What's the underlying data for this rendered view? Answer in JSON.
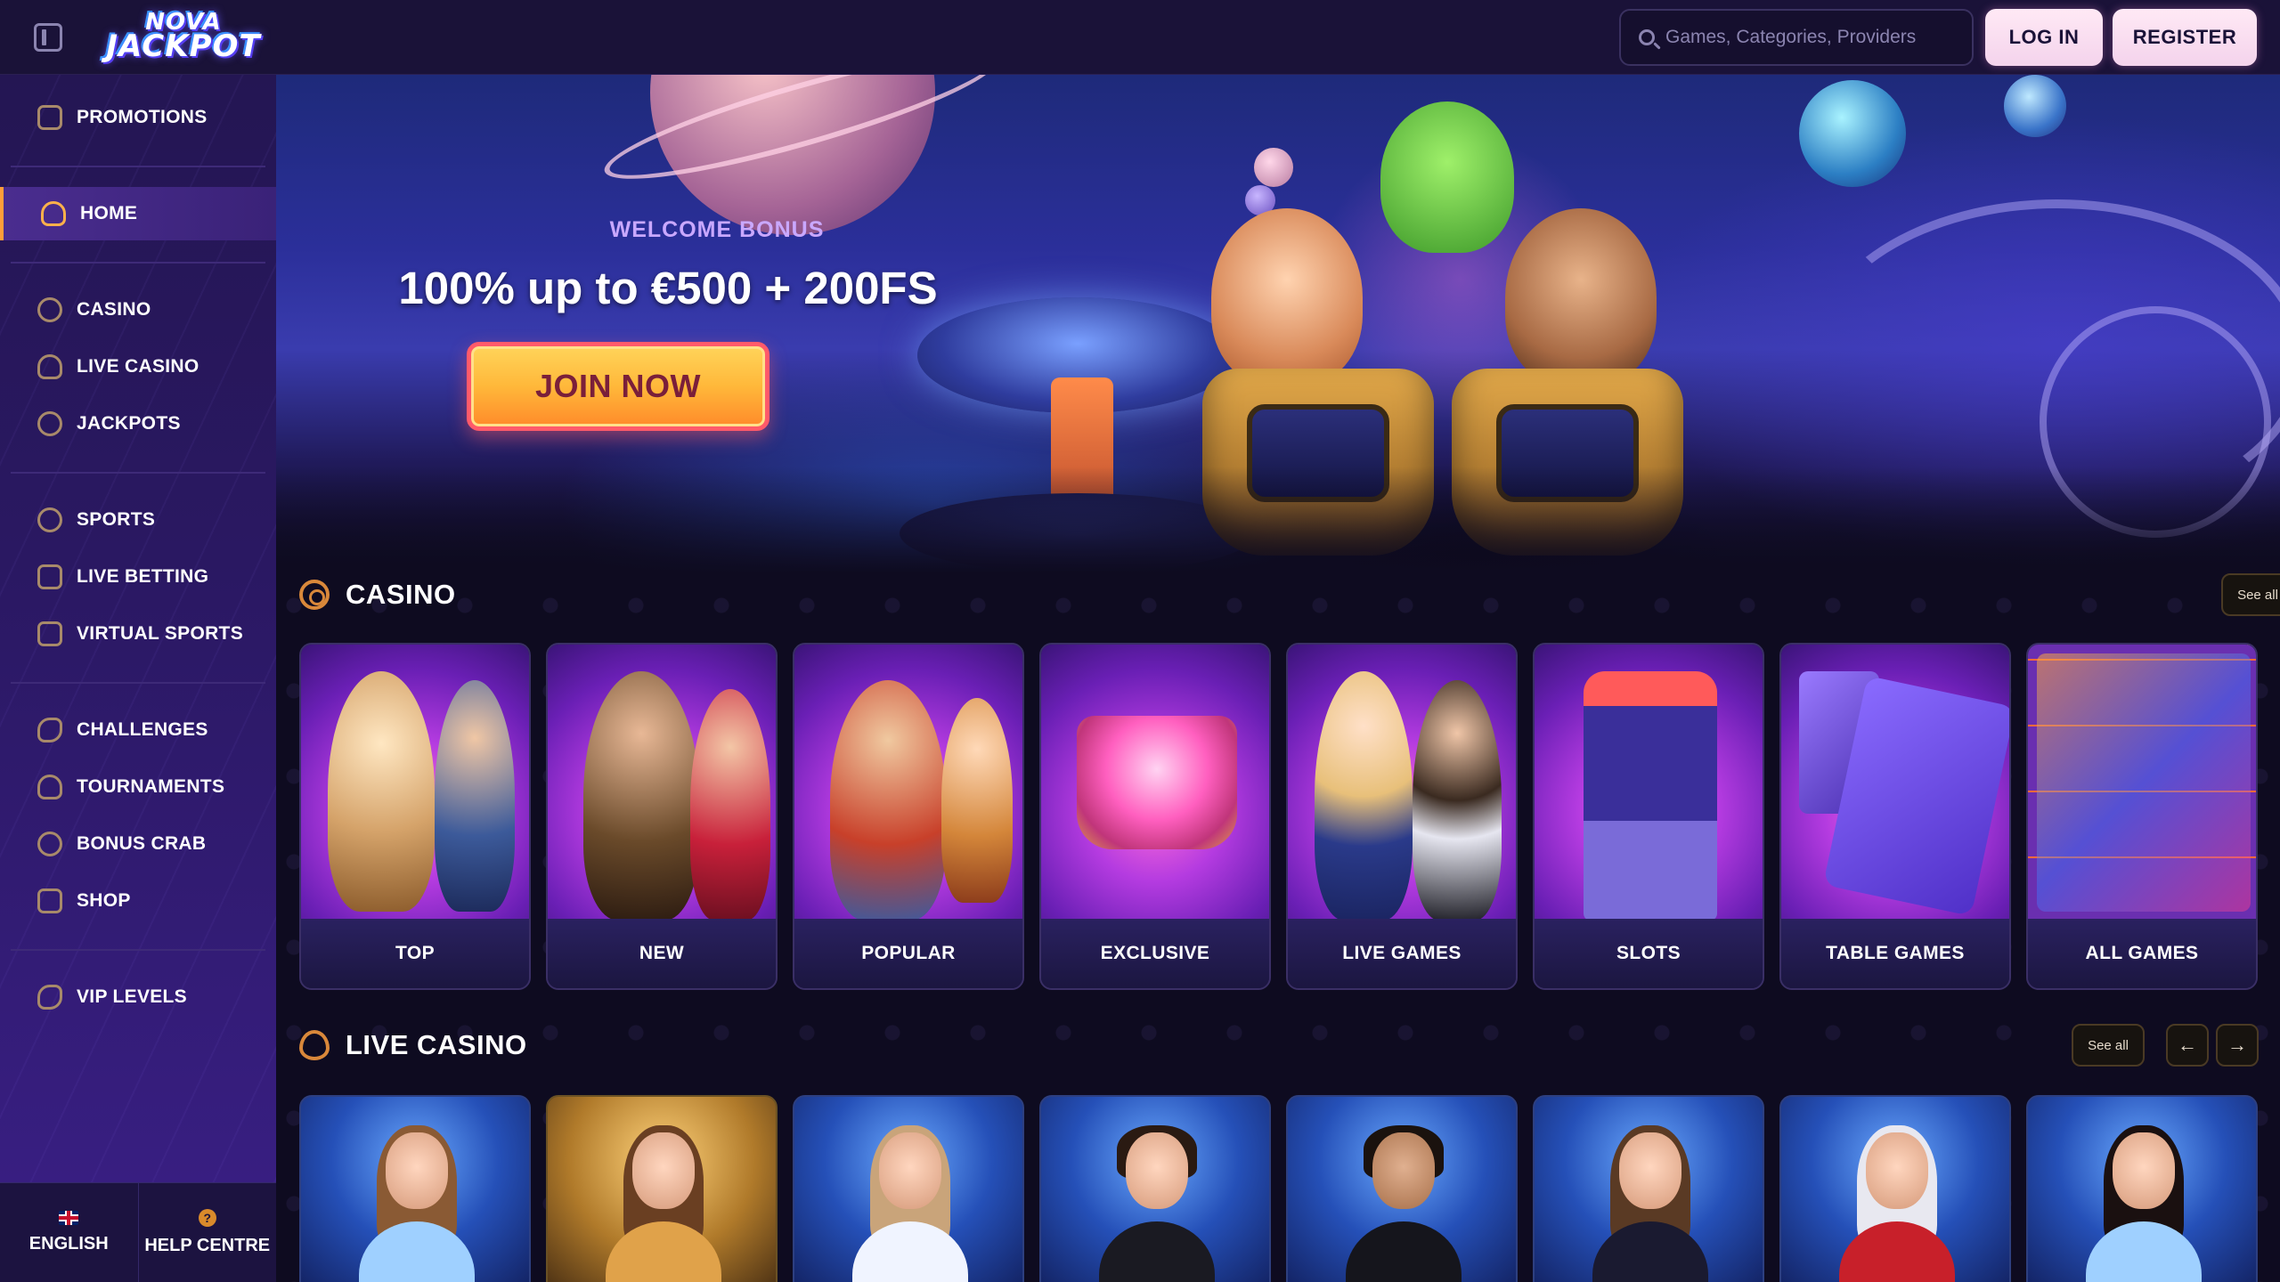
{
  "header": {
    "logo_line1": "NOVA",
    "logo_line2": "JACKPOT",
    "search_placeholder": "Games, Categories, Providers",
    "login_label": "LOG IN",
    "register_label": "REGISTER"
  },
  "sidebar": {
    "items": [
      {
        "label": "PROMOTIONS",
        "icon": "gift-icon"
      },
      {
        "label": "HOME",
        "icon": "home-icon",
        "active": true
      },
      {
        "label": "CASINO",
        "icon": "chip-icon"
      },
      {
        "label": "LIVE CASINO",
        "icon": "spade-icon"
      },
      {
        "label": "JACKPOTS",
        "icon": "seven-icon"
      },
      {
        "label": "SPORTS",
        "icon": "ball-icon"
      },
      {
        "label": "LIVE BETTING",
        "icon": "play-icon"
      },
      {
        "label": "VIRTUAL SPORTS",
        "icon": "gamepad-icon"
      },
      {
        "label": "CHALLENGES",
        "icon": "medal-icon"
      },
      {
        "label": "TOURNAMENTS",
        "icon": "trophy-icon"
      },
      {
        "label": "BONUS CRAB",
        "icon": "crab-icon"
      },
      {
        "label": "SHOP",
        "icon": "shop-icon"
      },
      {
        "label": "VIP LEVELS",
        "icon": "crown-icon"
      }
    ],
    "language_label": "ENGLISH",
    "help_label": "HELP CENTRE"
  },
  "hero": {
    "kicker": "WELCOME BONUS",
    "title": "100% up to €500 + 200FS",
    "cta": "JOIN NOW"
  },
  "casino": {
    "title": "CASINO",
    "see_all": "See all",
    "categories": [
      "TOP",
      "NEW",
      "POPULAR",
      "EXCLUSIVE",
      "LIVE GAMES",
      "SLOTS",
      "TABLE GAMES",
      "ALL GAMES"
    ]
  },
  "live_casino": {
    "title": "LIVE CASINO",
    "see_all": "See all",
    "prev": "←",
    "next": "→"
  },
  "colors": {
    "accent_orange": "#d9883a",
    "header_bg": "#1a1238",
    "sidebar_bg": "#2a1862",
    "cta_yellow": "#ffb83a"
  }
}
